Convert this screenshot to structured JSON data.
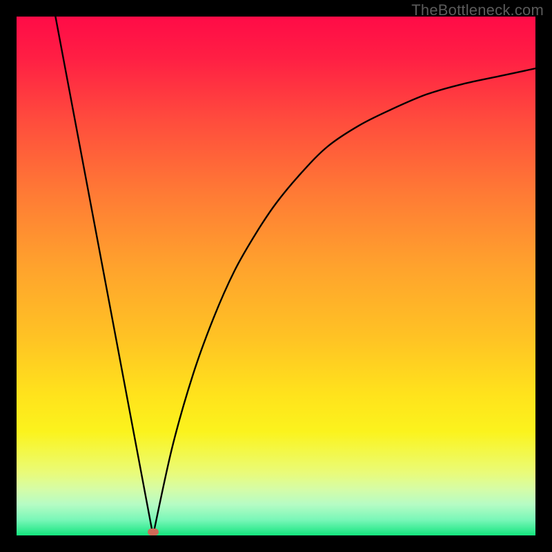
{
  "watermark": "TheBottleneck.com",
  "marker": {
    "x_frac": 0.263,
    "y_frac": 0.994
  },
  "colors": {
    "curve_stroke": "#000000",
    "marker_fill": "#cf6a58"
  },
  "chart_data": {
    "type": "line",
    "title": "",
    "xlabel": "",
    "ylabel": "",
    "xlim": [
      0,
      1
    ],
    "ylim": [
      0,
      1
    ],
    "series": [
      {
        "name": "left-branch",
        "x": [
          0.075,
          0.263
        ],
        "y": [
          1.0,
          0.0
        ]
      },
      {
        "name": "right-branch",
        "x": [
          0.263,
          0.3,
          0.34,
          0.38,
          0.42,
          0.46,
          0.5,
          0.55,
          0.6,
          0.66,
          0.72,
          0.79,
          0.86,
          0.93,
          1.0
        ],
        "y": [
          0.0,
          0.17,
          0.31,
          0.42,
          0.51,
          0.58,
          0.64,
          0.7,
          0.75,
          0.79,
          0.82,
          0.85,
          0.87,
          0.885,
          0.9
        ]
      }
    ],
    "annotations": [
      {
        "type": "marker",
        "x": 0.263,
        "y": 0.006,
        "label": ""
      }
    ]
  }
}
